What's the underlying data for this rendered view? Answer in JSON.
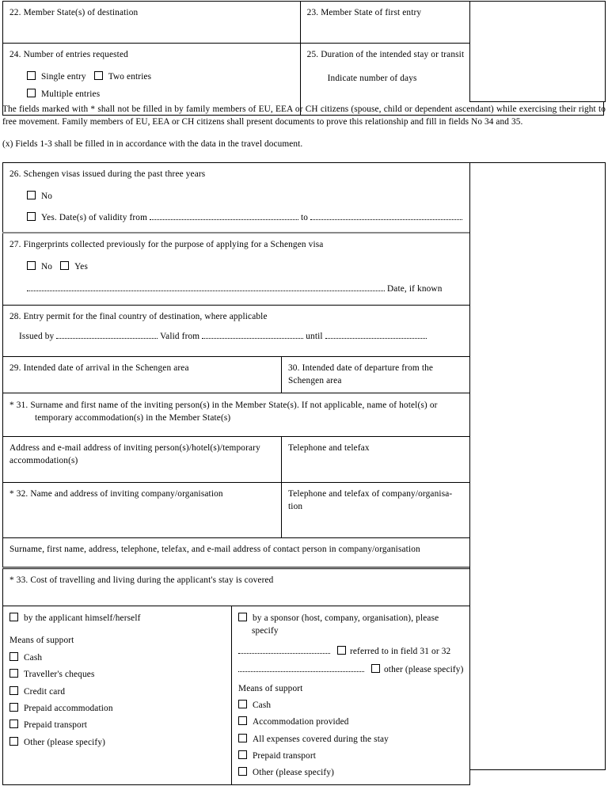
{
  "document": {
    "type": "schengen-visa-application-form",
    "page_label": ""
  },
  "fields_22_25": {
    "f22": {
      "number": "22.",
      "label": "Member State(s) of destination"
    },
    "f23": {
      "number": "23.",
      "label": "Member State of first entry"
    },
    "f24": {
      "number": "24.",
      "label": "Number of entries requested",
      "options": [
        "Single entry",
        "Two entries",
        "Multiple entries"
      ]
    },
    "f25": {
      "number": "25.",
      "label": "Duration of the intended stay or transit",
      "sub_label": "Indicate number of days"
    }
  },
  "notes": {
    "asterisk_note": "The fields marked with * shall not be filled in by family members of EU, EEA or CH citizens (spouse, child or dependent ascendant) while exercising their right to free movement. Family members of EU, EEA or CH citizens shall present documents to prove this relationship and fill in fields No 34 and 35.",
    "x_note": "(x) Fields 1-3 shall be filled in in accordance with the data in the travel document."
  },
  "fields_26_32": {
    "f26": {
      "number": "26.",
      "label": "Schengen visas issued during the past three years",
      "option_no": "No",
      "option_yes_prefix": "Yes. Date(s) of validity from",
      "option_yes_mid": "to"
    },
    "f27": {
      "number": "27.",
      "label": "Fingerprints collected previously for the purpose of applying for a Schengen visa",
      "option_no": "No",
      "option_yes": "Yes",
      "date_hint": "Date, if known"
    },
    "f28": {
      "number": "28.",
      "label": "Entry permit for the final country of destination, where applicable",
      "issued_by": "Issued by",
      "valid_from": "Valid from",
      "until": "until"
    },
    "f29": {
      "number": "29.",
      "label": "Intended date of arrival in the Schengen area"
    },
    "f30": {
      "number": "30.",
      "label": "Intended date of departure from the Schengen area"
    },
    "f31": {
      "number": "* 31.",
      "label_line1": "Surname and first name of the inviting person(s) in the Member State(s). If not applicable, name of hotel(s)",
      "label_line2": "or temporary accommodation(s) in the Member State(s)"
    },
    "address_row": {
      "left": "Address and e-mail address of inviting person(s)/hotel(s)/temporary accommodation(s)",
      "right": "Telephone and telefax"
    },
    "f32": {
      "number": "* 32.",
      "label": "Name and address of inviting company/organisation",
      "right": "Telephone and telefax of company/organisa-tion"
    },
    "contact_row": "Surname, first name, address, telephone, telefax, and e-mail address of contact person in company/organisation"
  },
  "field_33": {
    "number": "* 33.",
    "heading": "Cost of travelling and living during the applicant's stay is covered",
    "left_column": {
      "main_option": "by the applicant himself/herself",
      "means_of_support_label": "Means of support",
      "options": [
        "Cash",
        "Traveller's cheques",
        "Credit card",
        "Prepaid accommodation",
        "Prepaid transport",
        "Other (please specify)"
      ]
    },
    "right_column": {
      "main_option": "by a sponsor (host, company, organisation), please specify",
      "referred_option": "referred to in field 31 or 32",
      "other_option": "other (please specify)",
      "means_of_support_label": "Means of support",
      "options": [
        "Cash",
        "Accommodation provided",
        "All expenses covered during the stay",
        "Prepaid transport",
        "Other (please specify)"
      ]
    }
  },
  "colors": {
    "border": "#000000",
    "text": "#000000",
    "background": "#ffffff",
    "separator": "#888888"
  }
}
